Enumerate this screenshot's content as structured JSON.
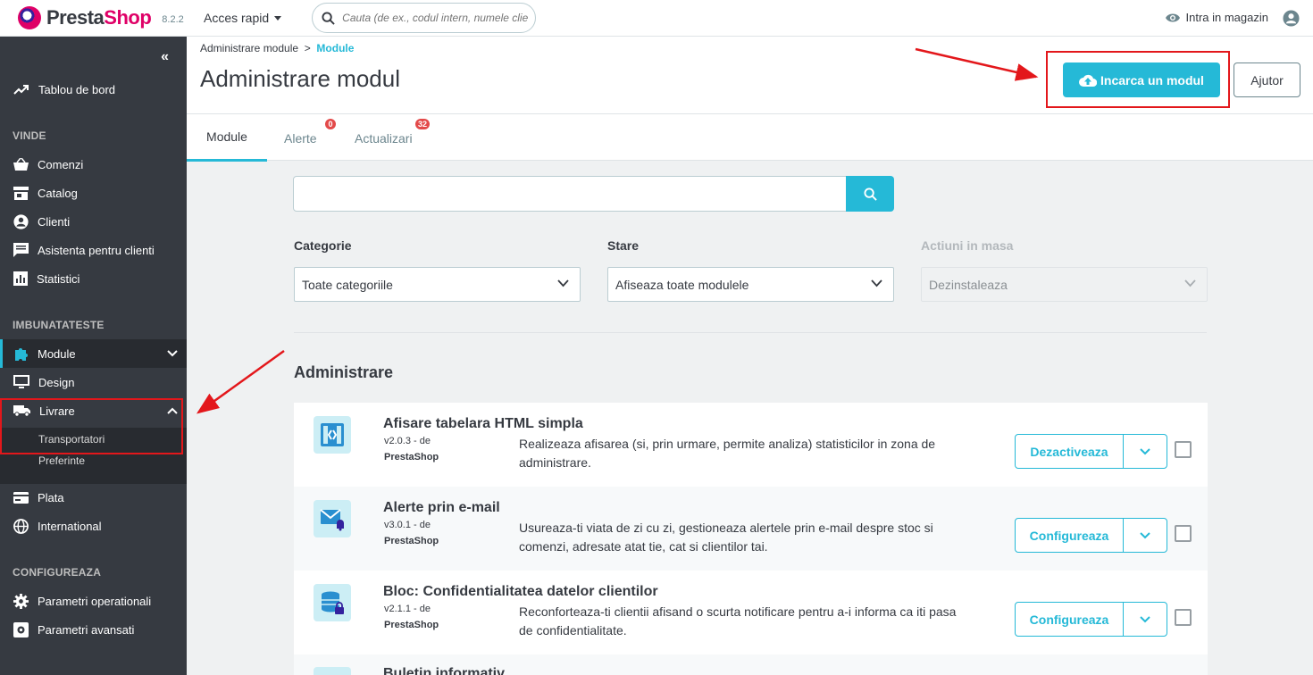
{
  "topbar": {
    "brand_a": "Presta",
    "brand_b": "Shop",
    "version": "8.2.2",
    "quick_access": "Acces rapid",
    "search_placeholder": "Cauta (de ex., codul intern, numele clie",
    "store_link": "Intra in magazin"
  },
  "sidebar": {
    "dashboard": "Tablou de bord",
    "section_sell": "VINDE",
    "orders": "Comenzi",
    "catalog": "Catalog",
    "customers": "Clienti",
    "support": "Asistenta pentru clienti",
    "stats": "Statistici",
    "section_improve": "IMBUNATATESTE",
    "modules": "Module",
    "design": "Design",
    "shipping": "Livrare",
    "carriers": "Transportatori",
    "preferences": "Preferinte",
    "payment": "Plata",
    "international": "International",
    "section_configure": "CONFIGUREAZA",
    "operational": "Parametri operationali",
    "advanced": "Parametri avansati"
  },
  "header": {
    "breadcrumb_parent": "Administrare module",
    "breadcrumb_sep": ">",
    "breadcrumb_current": "Module",
    "title": "Administrare modul",
    "upload_button": "Incarca un modul",
    "help_button": "Ajutor",
    "tabs": [
      {
        "label": "Module",
        "badge": ""
      },
      {
        "label": "Alerte",
        "badge": "0"
      },
      {
        "label": "Actualizari",
        "badge": "32"
      }
    ]
  },
  "filters": {
    "category_label": "Categorie",
    "category_value": "Toate categoriile",
    "status_label": "Stare",
    "status_value": "Afiseaza toate modulele",
    "bulk_label": "Actiuni in masa",
    "bulk_value": "Dezinstaleaza"
  },
  "category_title": "Administrare",
  "modules": [
    {
      "name": "Afisare tabelara HTML simpla",
      "version": "v2.0.3 - de",
      "author": "PrestaShop",
      "description": "Realizeaza afisarea (si, prin urmare, permite analiza) statisticilor in zona de administrare.",
      "action": "Dezactiveaza"
    },
    {
      "name": "Alerte prin e-mail",
      "version": "v3.0.1 - de",
      "author": "PrestaShop",
      "description": "Usureaza-ti viata de zi cu zi, gestioneaza alertele prin e-mail despre stoc si comenzi, adresate atat tie, cat si clientilor tai.",
      "action": "Configureaza"
    },
    {
      "name": "Bloc: Confidentialitatea datelor clientilor",
      "version": "v2.1.1 - de",
      "author": "PrestaShop",
      "description": "Reconforteaza-ti clientii afisand o scurta notificare pentru a-i informa ca iti pasa de confidentialitate.",
      "action": "Configureaza"
    },
    {
      "name": "Buletin informativ",
      "version": "",
      "author": "",
      "description": "",
      "action": ""
    }
  ],
  "colors": {
    "accent": "#25b9d7",
    "sidebar": "#363a41",
    "highlight": "#e3171b",
    "brand": "#df0067"
  }
}
